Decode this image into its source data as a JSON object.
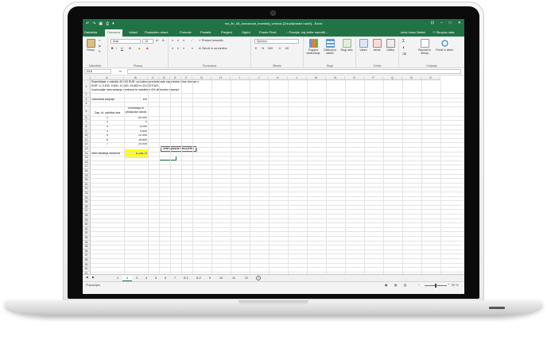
{
  "window": {
    "title": "mo_fin_08_donosnost_investicij_vredost [Združljivostni način] - Excel",
    "qat_icons": [
      "save-icon",
      "undo-icon",
      "redo-icon"
    ]
  },
  "tabs": [
    {
      "label": "Datoteka"
    },
    {
      "label": "Osnovno"
    },
    {
      "label": "Vstavi"
    },
    {
      "label": "Postavitev strani"
    },
    {
      "label": "Formule"
    },
    {
      "label": "Podatki"
    },
    {
      "label": "Pregled"
    },
    {
      "label": "Ogled"
    },
    {
      "label": "Power Pivot"
    }
  ],
  "tell_me": "Povejte, kaj želite narediti ...",
  "user": "Iztok Ivanc Bašek",
  "share_label": "Skupna raba",
  "ribbon": {
    "paste_label": "Prilepi",
    "clipboard_label": "Odložišče",
    "font_name": "Arial",
    "font_size": "10",
    "font_label": "Pisava",
    "wrap_text": "Prelomi besedilo",
    "merge_center": "Združi in na sredino",
    "alignment_label": "Poravnava",
    "number_format": "Splošno",
    "number_label": "Število",
    "cond_format": "Pogojno oblikovanje",
    "format_table": "Oblikuj kot tabelo",
    "cell_styles": "Slogi celic",
    "styles_label": "Slogi",
    "insert": "Vstavi",
    "delete": "Izbriši",
    "format": "Oblika",
    "cells_label": "Celice",
    "sort_filter": "Razvrsti in filtriraj",
    "find_select": "Poišči in izberi",
    "editing_label": "Urejanje"
  },
  "formula_bar": {
    "name_box": "D15",
    "fx": "fx",
    "formula": ""
  },
  "grid": {
    "columns": [
      "A",
      "B",
      "C",
      "D",
      "E",
      "F",
      "G",
      "H",
      "I",
      "J",
      "K",
      "L",
      "M",
      "N",
      "O",
      "P",
      "Q",
      "R",
      "S"
    ],
    "rows": [
      "1",
      "2",
      "3",
      "4",
      "5",
      "6",
      "7",
      "8",
      "9",
      "10",
      "11",
      "12",
      "13",
      "14",
      "15",
      "16",
      "17",
      "18",
      "19",
      "20",
      "21",
      "22",
      "23",
      "24",
      "25",
      "26",
      "27",
      "28",
      "29",
      "30",
      "31",
      "32",
      "33",
      "34",
      "35",
      "36",
      "37",
      "38",
      "39",
      "40",
      "41",
      "42",
      "43"
    ],
    "a1_line1": "Razmišljate o naložbi 40.000 EUR, za katero predvidevate zaporedne letne donose v",
    "a1_line2": "EUR: 0, 5.200, 9.600, 12.000, 16.800 in 20.000 EUR.",
    "a1_line3": "Izračunajte neto sedanjo vrednost te naložbe s 6% diskontno stopnjo!",
    "discount_label": "Diskontna stopnja",
    "discount_value": "6%",
    "header_a": "Zap. št. začetka leta",
    "header_b_line1": "Investicija in",
    "header_b_line2": "pričakovani donosi",
    "table": [
      {
        "n": "1",
        "v": "-40.000"
      },
      {
        "n": "2",
        "v": "0"
      },
      {
        "n": "3",
        "v": "5.200"
      },
      {
        "n": "4",
        "v": "9.600"
      },
      {
        "n": "5",
        "v": "12.000"
      },
      {
        "n": "6",
        "v": "16.800"
      },
      {
        "n": "7",
        "v": "20.000"
      }
    ],
    "npv_label": "Neto sedanja vrednost",
    "npv_value": "8.248,79",
    "formula_hint": "=NPV(B3;B7:B12)+B6"
  },
  "sheets": [
    "1",
    "2",
    "3",
    "4",
    "5",
    "6",
    "7",
    "8-1",
    "8-2",
    "9",
    "10",
    "11",
    "12"
  ],
  "active_sheet": "2",
  "status": {
    "ready": "Pripravljen",
    "zoom": "90 %"
  },
  "colors": {
    "excel_green": "#217346",
    "highlight": "#ffff00"
  }
}
